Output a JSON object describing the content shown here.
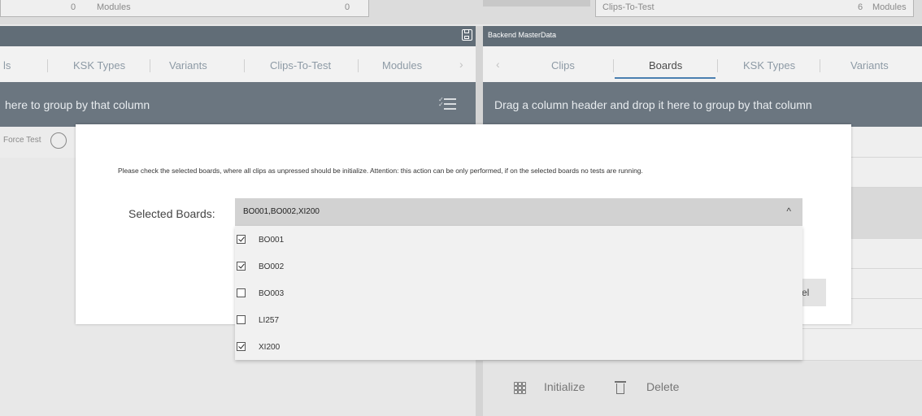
{
  "top": {
    "left_count": "0",
    "left_label": "Modules",
    "left_count2": "0",
    "right_label": "Clips-To-Test",
    "right_count": "6",
    "right_label2": "Modules"
  },
  "left_panel": {
    "tabs": [
      {
        "label": "ls"
      },
      {
        "label": "KSK Types"
      },
      {
        "label": "Variants"
      },
      {
        "label": "Clips-To-Test"
      },
      {
        "label": "Modules"
      }
    ],
    "group_text": "here to group by that column",
    "filter_text": "Force Test"
  },
  "right_panel": {
    "title": "Backend MasterData",
    "tabs": [
      {
        "label": "Clips"
      },
      {
        "label": "Boards"
      },
      {
        "label": "KSK Types"
      },
      {
        "label": "Variants"
      }
    ],
    "active_tab": "Boards",
    "group_text": "Drag a column header and drop it here to group by that column",
    "actions": {
      "initialize": "Initialize",
      "delete": "Delete"
    }
  },
  "dialog": {
    "message": "Please check the selected boards, where all clips as unpressed should be initialize. Attention: this action can be only performed, if on the selected boards no tests are running.",
    "label": "Selected Boards:",
    "selected_value": "BO001,BO002,XI200",
    "cancel_partial": "el",
    "options": [
      {
        "label": "BO001",
        "checked": true
      },
      {
        "label": "BO002",
        "checked": true
      },
      {
        "label": "BO003",
        "checked": false
      },
      {
        "label": "LI257",
        "checked": false
      },
      {
        "label": "XI200",
        "checked": true
      }
    ]
  },
  "colors": {
    "header": "#616d77",
    "group_bar": "#6b7680",
    "accent": "#4a7fb0"
  }
}
